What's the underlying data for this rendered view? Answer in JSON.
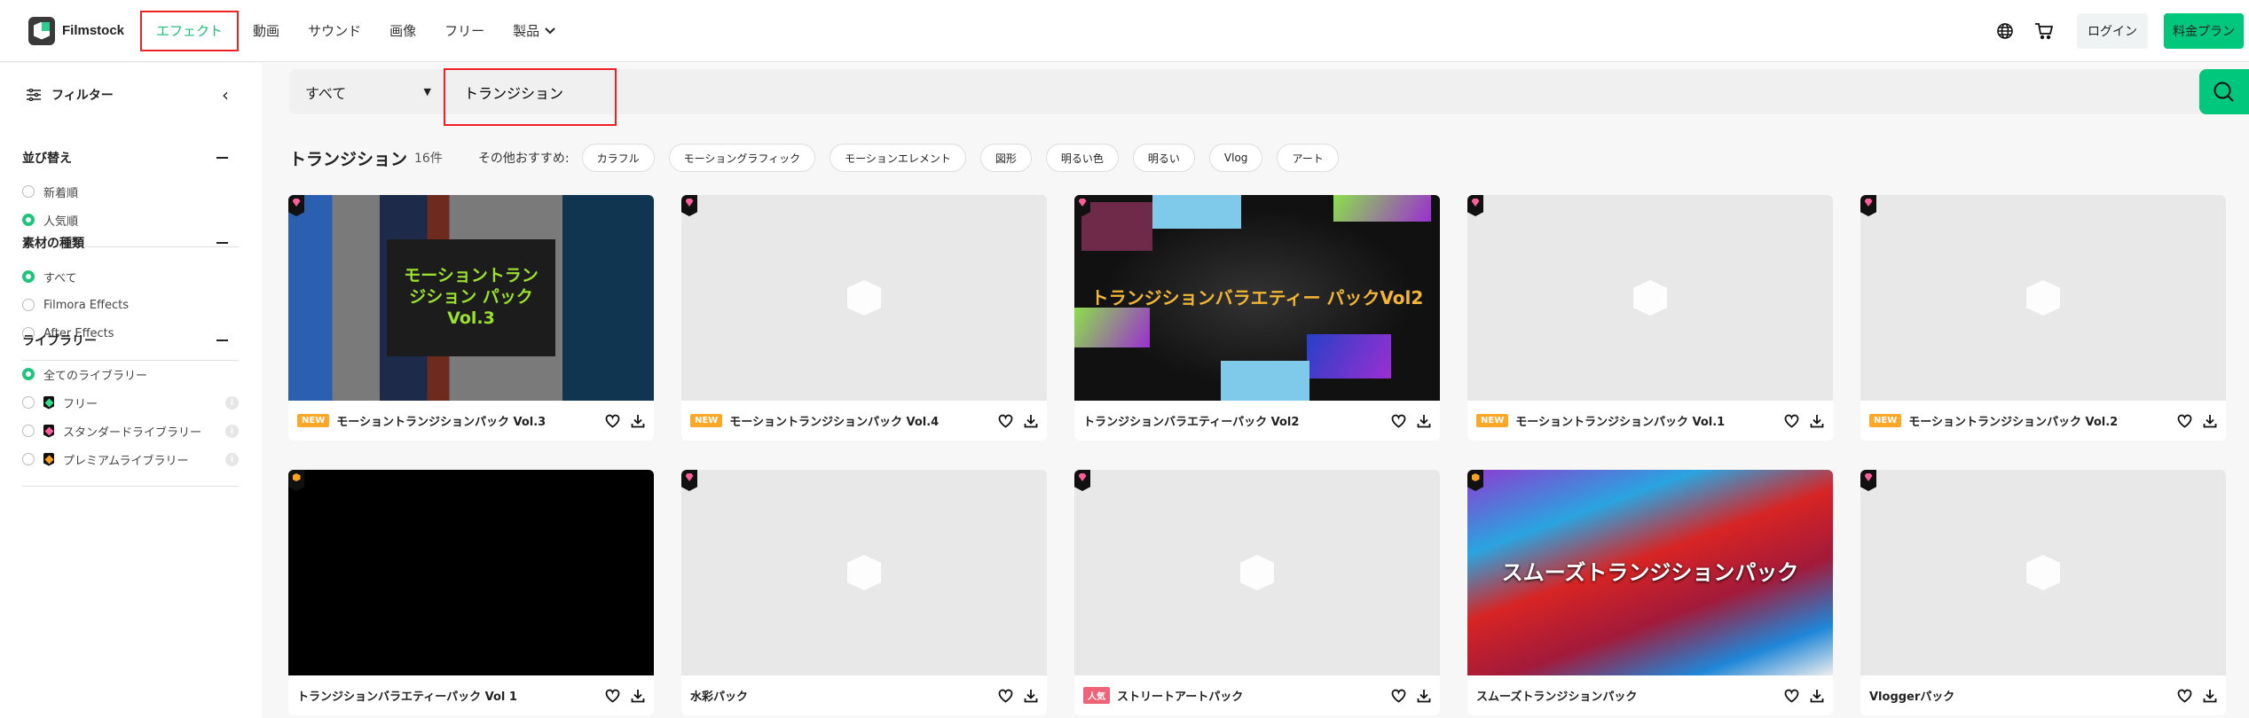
{
  "header": {
    "brand": "Filmstock",
    "nav": [
      {
        "label": "エフェクト",
        "active": true
      },
      {
        "label": "動画"
      },
      {
        "label": "サウンド"
      },
      {
        "label": "画像"
      },
      {
        "label": "フリー"
      },
      {
        "label": "製品"
      }
    ],
    "login": "ログイン",
    "plan": "料金プラン",
    "accent": "#00c77b"
  },
  "sidebar": {
    "title": "フィルター",
    "sections": [
      {
        "title": "並び替え",
        "options": [
          {
            "label": "新着順",
            "checked": false
          },
          {
            "label": "人気順",
            "checked": true
          }
        ]
      },
      {
        "title": "素材の種類",
        "options": [
          {
            "label": "すべて",
            "checked": true
          },
          {
            "label": "Filmora Effects",
            "checked": false
          },
          {
            "label": "After Effects",
            "checked": false
          }
        ]
      },
      {
        "title": "ライブラリー",
        "options": [
          {
            "label": "全てのライブラリー",
            "checked": true
          },
          {
            "label": "フリー",
            "tier": "free",
            "checked": false
          },
          {
            "label": "スタンダードライブラリー",
            "tier": "standard",
            "checked": false
          },
          {
            "label": "プレミアムライブラリー",
            "tier": "premium",
            "checked": false
          }
        ]
      }
    ]
  },
  "search": {
    "scope": "すべて",
    "query": "トランジション"
  },
  "results": {
    "title": "トランジション",
    "count": "16件",
    "rec_label": "その他おすすめ:",
    "tags": [
      "カラフル",
      "モーショングラフィック",
      "モーションエレメント",
      "図形",
      "明るい色",
      "明るい",
      "Vlog",
      "アート"
    ]
  },
  "cards": [
    {
      "title": "モーショントランジションパック Vol.3",
      "badge": "NEW",
      "tier": "standard",
      "thumb": "pattern",
      "caption": "モーショントランジション パック Vol.3"
    },
    {
      "title": "モーショントランジションパック Vol.4",
      "badge": "NEW",
      "tier": "standard",
      "thumb": "placeholder"
    },
    {
      "title": "トランジションバラエティーパック Vol2",
      "tier": "standard",
      "thumb": "variety",
      "caption": "トランジションバラエティー パックVol2"
    },
    {
      "title": "モーショントランジションパック Vol.1",
      "badge": "NEW",
      "tier": "standard",
      "thumb": "placeholder"
    },
    {
      "title": "モーショントランジションパック Vol.2",
      "badge": "NEW",
      "tier": "standard",
      "thumb": "placeholder"
    },
    {
      "title": "トランジションバラエティーパック Vol 1",
      "tier": "premium",
      "thumb": "black"
    },
    {
      "title": "水彩パック",
      "tier": "standard",
      "thumb": "placeholder"
    },
    {
      "title": "ストリートアートパック",
      "badge": "人気",
      "tier": "standard",
      "thumb": "placeholder"
    },
    {
      "title": "スムーズトランジションパック",
      "tier": "premium",
      "thumb": "marble",
      "caption": "スムーズトランジションパック"
    },
    {
      "title": "Vloggerパック",
      "tier": "standard",
      "thumb": "placeholder"
    }
  ]
}
